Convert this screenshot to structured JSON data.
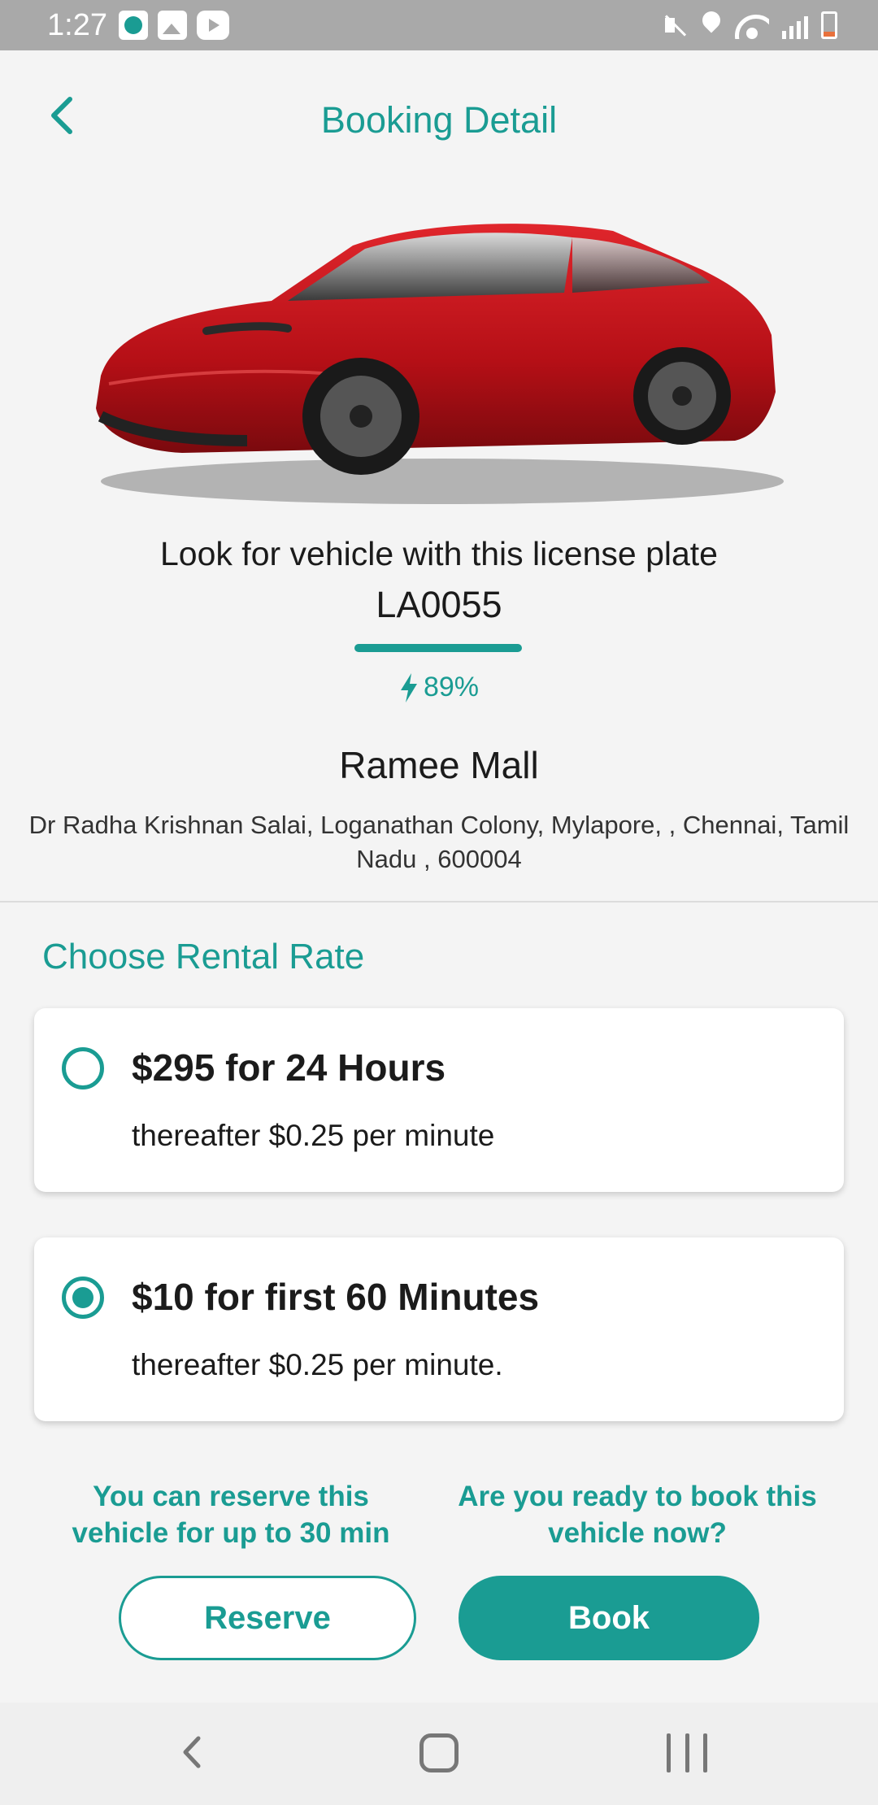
{
  "status_bar": {
    "time": "1:27"
  },
  "header": {
    "title": "Booking Detail",
    "back_icon": "chevron-left-icon"
  },
  "vehicle": {
    "image_description_icon": "car-image",
    "plate_caption": "Look for vehicle with this license plate",
    "plate_number": "LA0055",
    "battery_icon": "lightning-bolt-icon",
    "battery_level": "89%"
  },
  "location": {
    "name": "Ramee Mall",
    "address": "Dr Radha Krishnan Salai, Loganathan Colony, Mylapore, , Chennai, Tamil Nadu , 600004"
  },
  "rental": {
    "section_title": "Choose Rental Rate",
    "options": [
      {
        "title": "$295 for 24 Hours",
        "subtitle": "thereafter $0.25 per minute",
        "selected": false
      },
      {
        "title": "$10 for first 60 Minutes",
        "subtitle": "thereafter $0.25 per minute.",
        "selected": true
      }
    ]
  },
  "actions": {
    "reserve_hint": "You can reserve this vehicle for up to 30 min",
    "book_hint": "Are you ready to book this vehicle now?",
    "reserve_label": "Reserve",
    "book_label": "Book"
  },
  "colors": {
    "accent": "#1a9c93",
    "car_red": "#c8141c",
    "background": "#f4f4f4"
  }
}
